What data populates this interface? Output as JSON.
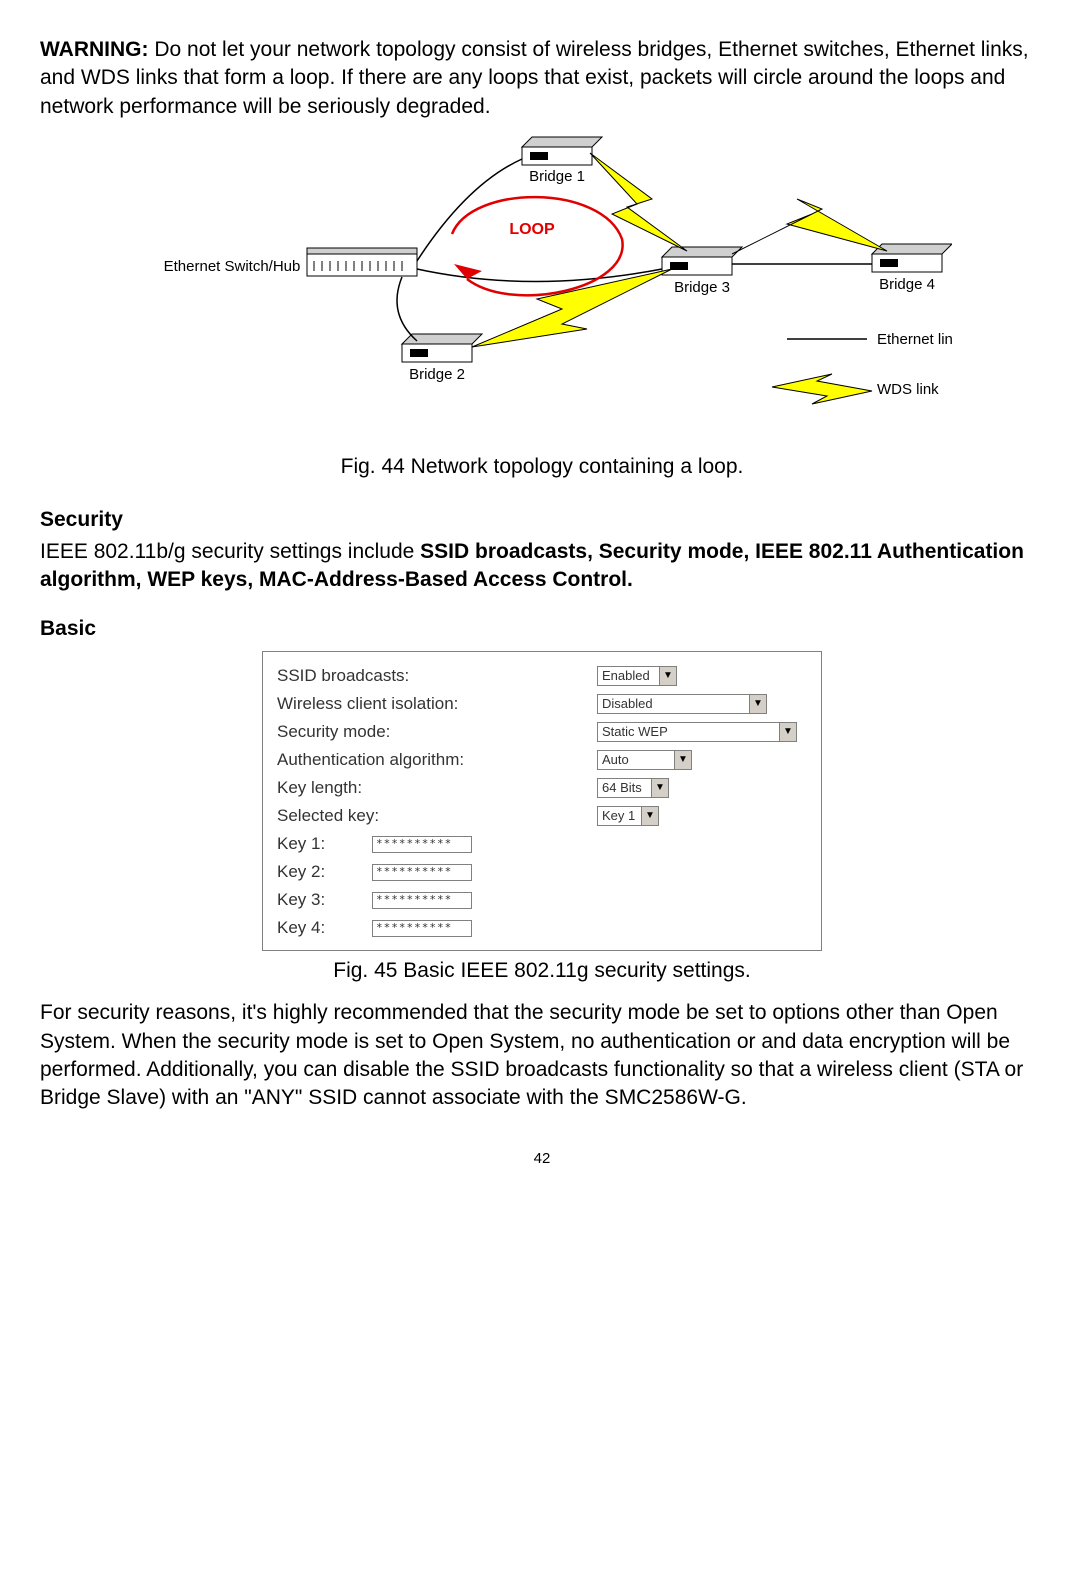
{
  "warning": {
    "label": "WARNING:",
    "text": " Do not let your network topology consist of wireless bridges, Ethernet switches, Ethernet links, and WDS links that form a loop. If there are any loops that exist, packets will circle around the loops and network performance will be seriously degraded."
  },
  "diagram": {
    "loop_label": "LOOP",
    "ethernet_switch_hub": "Ethernet Switch/Hub",
    "bridge1": "Bridge 1",
    "bridge2": "Bridge 2",
    "bridge3": "Bridge 3",
    "bridge4": "Bridge 4",
    "legend_ethernet": "Ethernet link",
    "legend_wds": "WDS link"
  },
  "fig44": "Fig. 44 Network topology containing a loop.",
  "security": {
    "heading": "Security",
    "intro_a": "IEEE 802.11b/g security settings include ",
    "intro_b": "SSID broadcasts, Security mode, IEEE 802.11 Authentication algorithm, WEP keys, MAC-Address-Based Access Control."
  },
  "basic": {
    "heading": "Basic",
    "rows": {
      "ssid_broadcasts_label": "SSID broadcasts:",
      "ssid_broadcasts_value": "Enabled",
      "wireless_iso_label": "Wireless client isolation:",
      "wireless_iso_value": "Disabled",
      "security_mode_label": "Security mode:",
      "security_mode_value": "Static WEP",
      "auth_algo_label": "Authentication algorithm:",
      "auth_algo_value": "Auto",
      "key_length_label": "Key length:",
      "key_length_value": "64 Bits",
      "selected_key_label": "Selected key:",
      "selected_key_value": "Key 1",
      "key1_label": "Key 1:",
      "key2_label": "Key 2:",
      "key3_label": "Key 3:",
      "key4_label": "Key 4:",
      "key_mask": "**********"
    }
  },
  "fig45": "Fig. 45 Basic IEEE 802.11g security settings.",
  "closing": "For security reasons, it's highly recommended that the security mode be set to options other than Open System. When the security mode is set to Open System, no authentication or and data encryption will be performed. Additionally, you can disable the SSID broadcasts functionality so that a wireless client (STA or Bridge Slave) with an \"ANY\" SSID cannot associate with the SMC2586W-G.",
  "page_number": "42"
}
